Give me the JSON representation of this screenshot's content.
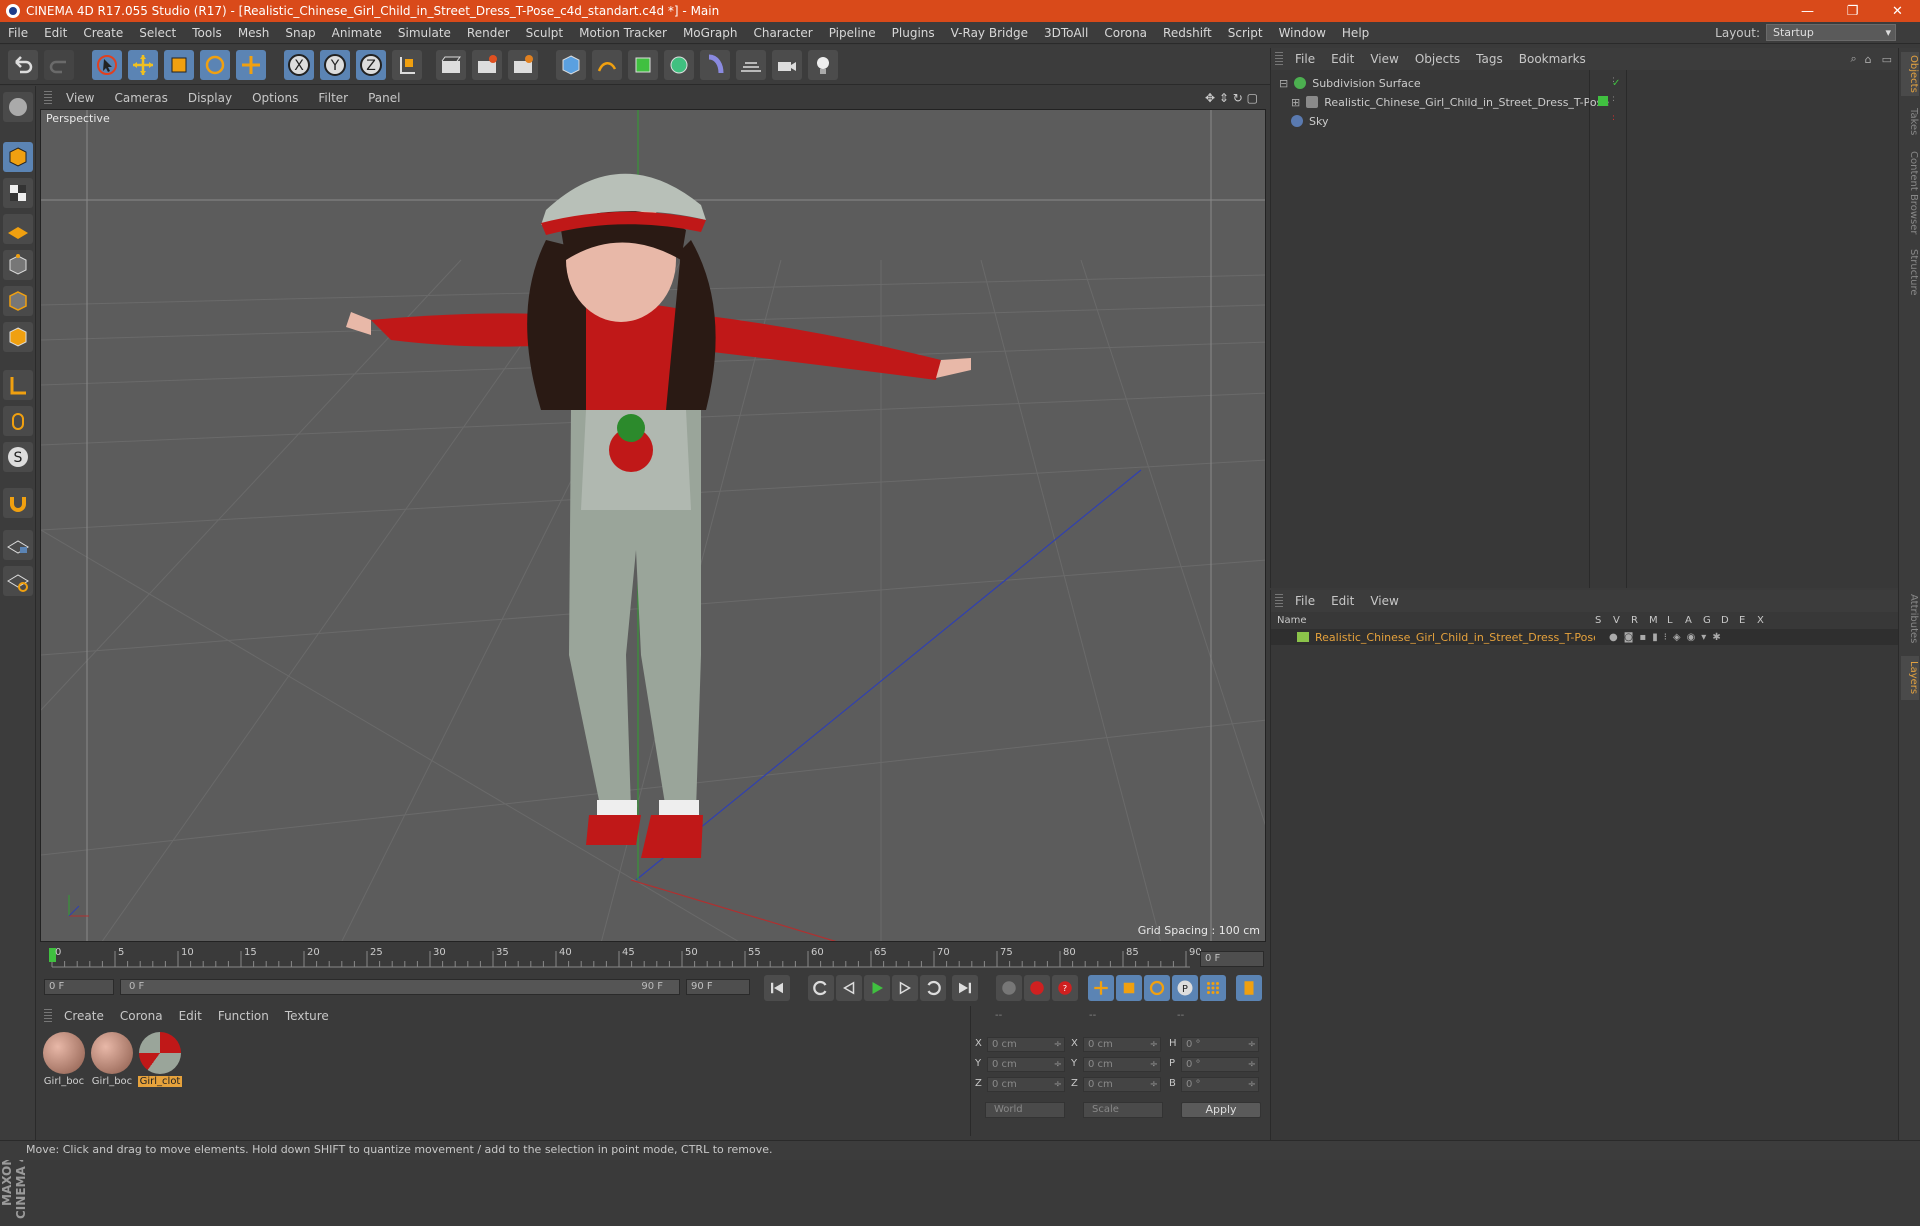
{
  "window": {
    "title": "CINEMA 4D R17.055 Studio (R17) - [Realistic_Chinese_Girl_Child_in_Street_Dress_T-Pose_c4d_standart.c4d *] - Main",
    "controls": {
      "minimize": "—",
      "restore": "❐",
      "close": "✕"
    }
  },
  "menu": [
    "File",
    "Edit",
    "Create",
    "Select",
    "Tools",
    "Mesh",
    "Snap",
    "Animate",
    "Simulate",
    "Render",
    "Sculpt",
    "Motion Tracker",
    "MoGraph",
    "Character",
    "Pipeline",
    "Plugins",
    "V-Ray Bridge",
    "3DToAll",
    "Corona",
    "Redshift",
    "Script",
    "Window",
    "Help"
  ],
  "layout": {
    "label": "Layout:",
    "value": "Startup"
  },
  "viewport": {
    "menu": [
      "View",
      "Cameras",
      "Display",
      "Options",
      "Filter",
      "Panel"
    ],
    "camera_label": "Perspective",
    "grid_spacing": "Grid Spacing : 100 cm"
  },
  "timeline": {
    "ticks": [
      "0",
      "5",
      "10",
      "15",
      "20",
      "25",
      "30",
      "35",
      "40",
      "45",
      "50",
      "55",
      "60",
      "65",
      "70",
      "75",
      "80",
      "85",
      "90"
    ],
    "current_frame": "0 F",
    "start_field": "0 F",
    "range_start": "0 F",
    "range_end": "90 F",
    "end_field": "90 F"
  },
  "materials": {
    "menu": [
      "Create",
      "Corona",
      "Edit",
      "Function",
      "Texture"
    ],
    "items": [
      {
        "label": "Girl_boc",
        "selected": false
      },
      {
        "label": "Girl_boc",
        "selected": false
      },
      {
        "label": "Girl_clot",
        "selected": true
      }
    ]
  },
  "coordinates": {
    "headers": [
      "--",
      "--",
      "--"
    ],
    "rows": [
      {
        "a": "X",
        "av": "0 cm",
        "b": "X",
        "bv": "0 cm",
        "c": "H",
        "cv": "0 °"
      },
      {
        "a": "Y",
        "av": "0 cm",
        "b": "Y",
        "bv": "0 cm",
        "c": "P",
        "cv": "0 °"
      },
      {
        "a": "Z",
        "av": "0 cm",
        "b": "Z",
        "bv": "0 cm",
        "c": "B",
        "cv": "0 °"
      }
    ],
    "world": "World",
    "scale": "Scale",
    "apply": "Apply"
  },
  "objects": {
    "menu": [
      "File",
      "Edit",
      "View",
      "Objects",
      "Tags",
      "Bookmarks"
    ],
    "items": [
      {
        "name": "Subdivision Surface",
        "color": "#4caf50"
      },
      {
        "name": "Realistic_Chinese_Girl_Child_in_Street_Dress_T-Pose",
        "color": "#8a8a8a"
      },
      {
        "name": "Sky",
        "color": "#5a7ab0"
      }
    ]
  },
  "layers": {
    "menu": [
      "File",
      "Edit",
      "View"
    ],
    "columns": [
      "Name",
      "S",
      "V",
      "R",
      "M",
      "L",
      "A",
      "G",
      "D",
      "E",
      "X"
    ],
    "row_name": "Realistic_Chinese_Girl_Child_in_Street_Dress_T-Pose"
  },
  "right_tabs": [
    "Objects",
    "Takes",
    "Content Browser",
    "Structure",
    "Attributes",
    "Layers"
  ],
  "brand": "MAXON CINEMA 4D",
  "status": "Move: Click and drag to move elements. Hold down SHIFT to quantize movement / add to the selection in point mode, CTRL to remove.",
  "colors": {
    "title_bar": "#d94a1a",
    "accent_orange": "#e6a23c",
    "tool_blue": "#5b84b4"
  }
}
